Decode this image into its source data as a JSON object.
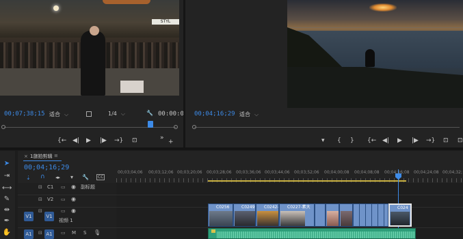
{
  "source_monitor": {
    "timecode": "00;07;38;15",
    "fit_label": "适合",
    "resolution": "1/4",
    "end_timecode": "00:00:0"
  },
  "program_monitor": {
    "timecode": "00;04;16;29",
    "fit_label": "适合"
  },
  "video_overlay": {
    "sign_text": "STYL"
  },
  "timeline": {
    "tab_label": "1旅拍剪辑",
    "tab_menu": "≡",
    "timecode": "00;04;16;29",
    "ruler": [
      "00;03;04;06",
      "00;03;12;06",
      "00;03;20;06",
      "00;03;28;06",
      "00;03;36;06",
      "00;03;44;06",
      "00;03;52;06",
      "00;04;00;08",
      "00;04;08;08",
      "00;04;16;08",
      "00;04;24;08",
      "00;04;32;"
    ],
    "tracks": [
      {
        "id": "C1",
        "label": "副标题"
      },
      {
        "id": "V2",
        "label": ""
      },
      {
        "id": "V1",
        "label": "视频 1",
        "src": "V1"
      },
      {
        "id": "A1",
        "label": "",
        "src": "A1"
      }
    ],
    "clips": [
      "C0256",
      "C0249",
      "C0242-",
      "C0227-素大",
      "",
      "",
      "C024"
    ],
    "cc_label": "CC",
    "lock_glyph": "🔒",
    "m_label": "M",
    "s_label": "S"
  },
  "icons": {
    "wrench": "🔧",
    "mark_in": "{",
    "mark_out": "}",
    "go_in": "{←",
    "step_back": "◀|",
    "play": "▶",
    "step_fwd": "|▶",
    "go_out": "→}",
    "insert": "⊡",
    "more": "»",
    "add": "+",
    "marker": "▾",
    "export": "⊡"
  }
}
